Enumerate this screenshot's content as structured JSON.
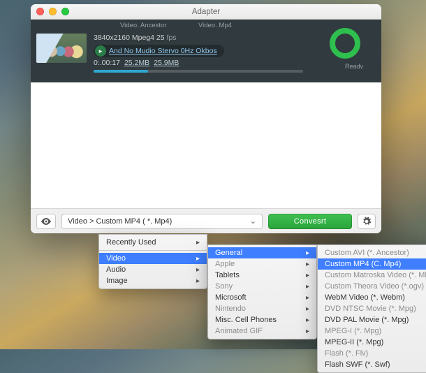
{
  "window": {
    "title": "Adapter"
  },
  "panel": {
    "col1": "Video. Ancestor",
    "col2": "Video. Mp4",
    "resolution": "3840x2160 Mpeg4 25",
    "fps_label": "fps",
    "audio_line": "And  No Mudio Stervo  0Hz Okbos",
    "time": "0:.00:17",
    "size1": "25.2MB",
    "size2": "25.9MB",
    "status": "Readv"
  },
  "footer": {
    "path": "Video > Custom MP4 ( *. Mp4)",
    "convert": "Convesrt"
  },
  "menus": {
    "m1": {
      "recent": "Recently Used",
      "video": "Video",
      "audio": "Audio",
      "image": "Image"
    },
    "m2": {
      "general": "General",
      "apple": "Apple",
      "tablets": "Tablets",
      "sony": "Sony",
      "microsoft": "Microsoft",
      "nintendo": "Nintendo",
      "misc": "Misc. Cell Phones",
      "gif": "Animated GIF"
    },
    "m3": {
      "avi": "Custom AVI (*. Ancestor)",
      "mp4": "Custom MP4 (C. Mp4)",
      "mkv": "Custom Matroska Video (*. Mkv)",
      "ogv": "Custom Theora Video (*.ogv)",
      "webm": "WebM Video (*. Webm)",
      "ntsc": "DVD NTSC Movie (*. Mpg)",
      "pal": "DVD PAL Movie (*. Mpg)",
      "mpeg1": "MPEG-I (*. Mpg)",
      "mpeg2": "MPEG-II (*. Mpg)",
      "flv": "Flash (*. Flv)",
      "swf": "Flash SWF (*. Swf)"
    }
  }
}
